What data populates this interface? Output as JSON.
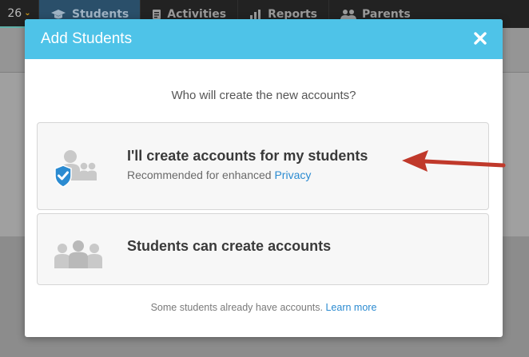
{
  "topnav": {
    "class_number": "26",
    "tabs": [
      {
        "label": "Students",
        "icon": "graduation-cap-icon",
        "active": true
      },
      {
        "label": "Activities",
        "icon": "document-icon",
        "active": false
      },
      {
        "label": "Reports",
        "icon": "bar-chart-icon",
        "active": false
      },
      {
        "label": "Parents",
        "icon": "people-icon",
        "active": false
      }
    ]
  },
  "modal": {
    "title": "Add Students",
    "close_icon": "close-icon",
    "question": "Who will create the new accounts?",
    "options": [
      {
        "title": "I'll create accounts for my students",
        "subtitle_prefix": "Recommended for enhanced ",
        "subtitle_link": "Privacy",
        "icon": "students-shield-icon"
      },
      {
        "title": "Students can create accounts",
        "icon": "students-group-icon"
      }
    ],
    "footer_text": "Some students already have accounts.",
    "footer_link": "Learn more"
  },
  "colors": {
    "header": "#4ec3e8",
    "link": "#2b8bd1",
    "shield": "#2b8bd1",
    "arrow": "#c0392b"
  }
}
